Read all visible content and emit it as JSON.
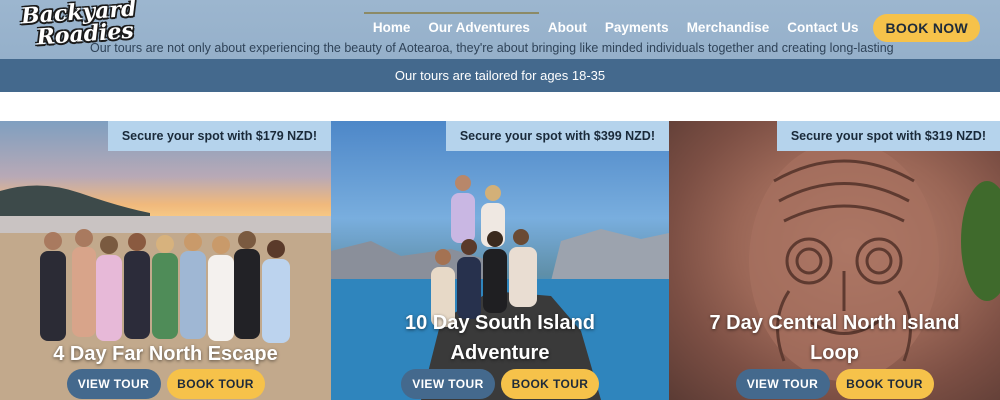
{
  "header": {
    "logo_line1": "Backyard",
    "logo_line2": "Roadies",
    "nav": [
      {
        "label": "Home"
      },
      {
        "label": "Our Adventures"
      },
      {
        "label": "About"
      },
      {
        "label": "Payments"
      },
      {
        "label": "Merchandise"
      },
      {
        "label": "Contact Us"
      }
    ],
    "book_now": "BOOK NOW",
    "intro": "Our tours are not only about experiencing the beauty of Aotearoa, they're about bringing like minded individuals together and creating long-lasting"
  },
  "banner": {
    "text": "Our tours are tailored for ages 18-35"
  },
  "tours": [
    {
      "promo": "Secure your spot with $179 NZD!",
      "title": "4 Day Far North Escape",
      "view_label": "VIEW TOUR",
      "book_label": "BOOK TOUR"
    },
    {
      "promo": "Secure your spot with $399 NZD!",
      "title_line1": "10 Day South Island",
      "title_line2": "Adventure",
      "view_label": "VIEW TOUR",
      "book_label": "BOOK TOUR"
    },
    {
      "promo": "Secure your spot with $319 NZD!",
      "title_line1": "7 Day Central North Island",
      "title_line2": "Loop",
      "view_label": "VIEW TOUR",
      "book_label": "BOOK TOUR"
    }
  ],
  "colors": {
    "header_bg": "#9cb6cf",
    "banner_bg": "#44698d",
    "accent_yellow": "#f6c24a",
    "promo_bg": "#b5d3ec",
    "view_button": "#44698d"
  }
}
